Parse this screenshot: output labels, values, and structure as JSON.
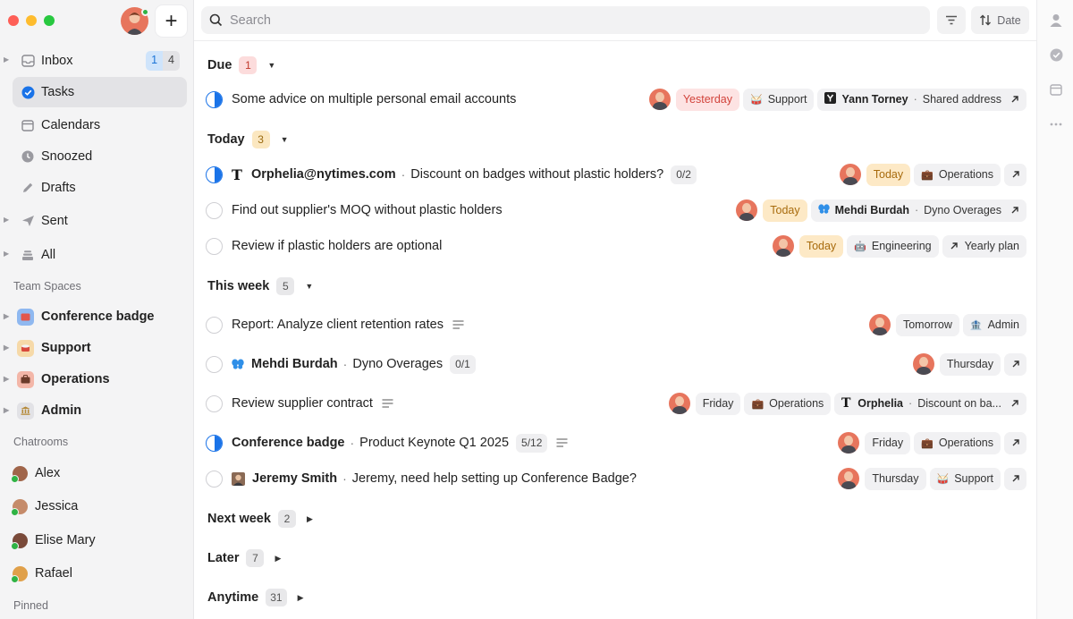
{
  "sidebar": {
    "inbox": {
      "label": "Inbox",
      "badge_unread": "1",
      "badge_total": "4"
    },
    "tasks": {
      "label": "Tasks"
    },
    "calendars": {
      "label": "Calendars"
    },
    "snoozed": {
      "label": "Snoozed"
    },
    "drafts": {
      "label": "Drafts"
    },
    "sent": {
      "label": "Sent"
    },
    "all": {
      "label": "All"
    },
    "team_spaces_label": "Team Spaces",
    "spaces": [
      {
        "label": "Conference badge",
        "icon": "ticket-icon",
        "color": "#8fb8f0"
      },
      {
        "label": "Support",
        "icon": "drum-icon",
        "color": "#f6d9a8"
      },
      {
        "label": "Operations",
        "icon": "briefcase-icon",
        "color": "#f3b6a8"
      },
      {
        "label": "Admin",
        "icon": "bank-icon",
        "color": "#e2e2e6"
      }
    ],
    "chatrooms_label": "Chatrooms",
    "chatrooms": [
      {
        "label": "Alex"
      },
      {
        "label": "Jessica"
      },
      {
        "label": "Elise Mary"
      },
      {
        "label": "Rafael"
      }
    ],
    "pinned_label": "Pinned"
  },
  "search": {
    "placeholder": "Search"
  },
  "sort": {
    "label": "Date"
  },
  "groups": {
    "due": {
      "label": "Due",
      "count": "1"
    },
    "today": {
      "label": "Today",
      "count": "3"
    },
    "this_week": {
      "label": "This week",
      "count": "5"
    },
    "next_week": {
      "label": "Next week",
      "count": "2"
    },
    "later": {
      "label": "Later",
      "count": "7"
    },
    "anytime": {
      "label": "Anytime",
      "count": "31"
    }
  },
  "tasks": {
    "t1": {
      "title": "Some advice on multiple personal email accounts",
      "date": "Yesterday",
      "space": "Support",
      "thread_name": "Yann Torney",
      "thread_sub": "Shared address"
    },
    "t2": {
      "sender": "Orphelia@nytimes.com",
      "title": "Discount on badges without plastic holders?",
      "sub": "0/2",
      "date": "Today",
      "space": "Operations"
    },
    "t3": {
      "title": "Find out supplier's MOQ without plastic holders",
      "date": "Today",
      "thread_name": "Mehdi Burdah",
      "thread_sub": "Dyno Overages"
    },
    "t4": {
      "title": "Review if plastic holders are optional",
      "date": "Today",
      "space": "Engineering",
      "link": "Yearly plan"
    },
    "t5": {
      "title": "Report: Analyze client retention rates",
      "date": "Tomorrow",
      "space": "Admin"
    },
    "t6": {
      "sender": "Mehdi Burdah",
      "title": "Dyno Overages",
      "sub": "0/1",
      "date": "Thursday"
    },
    "t7": {
      "title": "Review supplier contract",
      "date": "Friday",
      "space": "Operations",
      "thread_name": "Orphelia",
      "thread_sub": "Discount on ba..."
    },
    "t8": {
      "sender": "Conference badge",
      "title": "Product Keynote Q1 2025",
      "sub": "5/12",
      "date": "Friday",
      "space": "Operations"
    },
    "t9": {
      "sender": "Jeremy Smith",
      "title": "Jeremy, need help setting up Conference Badge?",
      "date": "Thursday",
      "space": "Support"
    }
  }
}
